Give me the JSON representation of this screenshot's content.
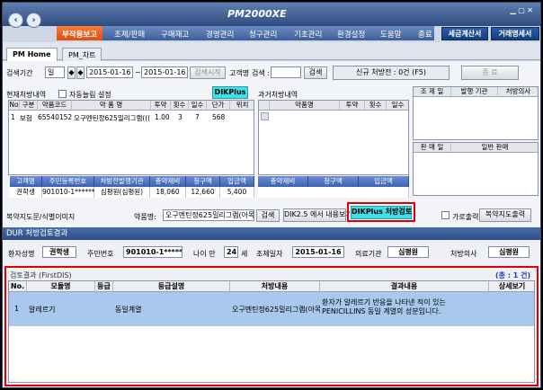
{
  "app": {
    "title": "PM2000XE"
  },
  "menu": {
    "items": [
      "부작용보고",
      "조제/판매",
      "구매재고",
      "경영관리",
      "청구관리",
      "기초관리",
      "환경설정",
      "도움말",
      "종료"
    ],
    "right_buttons": [
      "세금계산서",
      "거래명세서"
    ]
  },
  "tabs": [
    "PM Home",
    "PM_차트"
  ],
  "search": {
    "period_label": "검색기간",
    "period_unit": "일",
    "date_from": "2015-01-16",
    "tilde": "~",
    "date_to": "2015-01-16",
    "search_start_button": "검색시작",
    "customer_label": "고객명",
    "search_label": "검색 :",
    "search_value": "",
    "search_button": "검색",
    "new_rx_label": "신규 처방전 : 0건 (F5)",
    "end_button": "종 료"
  },
  "current_rx": {
    "title": "현재처방내역",
    "auto_refresh": "자동늘림 설정",
    "dikplus": "DIKPlus",
    "columns": [
      "No",
      "구분",
      "약품코드",
      "약 품 명",
      "투약",
      "횟수",
      "일수",
      "단가",
      "위치"
    ],
    "rows": [
      [
        "1",
        "보험",
        "655401520",
        "오구멘틴정625밀리그램(((",
        "1.00",
        "3",
        "7",
        "568",
        ""
      ]
    ]
  },
  "past_rx": {
    "title": "과거처방내역",
    "columns": [
      "",
      "약품명",
      "투약",
      "횟수",
      "일수"
    ]
  },
  "right_grid": {
    "columns": [
      "조 제 일",
      "발행 기관",
      "처방의사"
    ],
    "columns2": [
      "판 매 일",
      "일반 판매"
    ]
  },
  "patient": {
    "headers": [
      "고객명",
      "주민등록번호",
      "처방전발행기관",
      "총약제비",
      "청구액",
      "입금액"
    ],
    "values": [
      "권학생",
      "901010-1******",
      "심평원(심평원)",
      "18,060",
      "12,660",
      "5,400"
    ],
    "past_headers": [
      "총약제비",
      "청구액",
      "입금액"
    ]
  },
  "guide": {
    "label": "복약지도문/식별이미지",
    "drug_label": "약품명:",
    "drug_value": "오구멘틴정625밀리그램(아목",
    "search_button": "검색",
    "dik25_button": "DIK2.5 에서 내용보기",
    "dikplus_review": "DIKPlus 처방검토",
    "landscape": "가로출력",
    "print_button": "복약지도출력"
  },
  "dur": {
    "title": "DUR 처방검토결과",
    "patient_label": "환자성명",
    "patient_value": "권학생",
    "id_label": "주민번호",
    "id_value": "901010-1******",
    "age_label": "나이 만",
    "age_value": "24",
    "age_unit": "세",
    "date_label": "조제일자",
    "date_value": "2015-01-16",
    "org_label": "의료기관",
    "org_value": "심평원",
    "doctor_label": "처방의사",
    "doctor_value": "심평원",
    "result_title": "검토결과 (FirstDIS)",
    "total": "(총 : 1 건)",
    "columns": [
      "No.",
      "모듈명",
      "등급",
      "등급설명",
      "처방내용",
      "결과내용",
      "상세보기"
    ],
    "rows": [
      {
        "no": "1",
        "module": "알레르기",
        "grade": "",
        "grade_desc": "동일계열",
        "content": "오구멘틴정625밀리그램(아목",
        "result1": "환자가 알레르기 반응을 나타낸 적이 있는",
        "result2": "PENICILLINS 동일 계열의 성분입니다.",
        "detail": ""
      }
    ]
  },
  "colors": {
    "accent": "#e00000",
    "menu_active": "#ff6a2a",
    "header_blue": "#3d63b0",
    "dikplus": "#40e0e8"
  }
}
